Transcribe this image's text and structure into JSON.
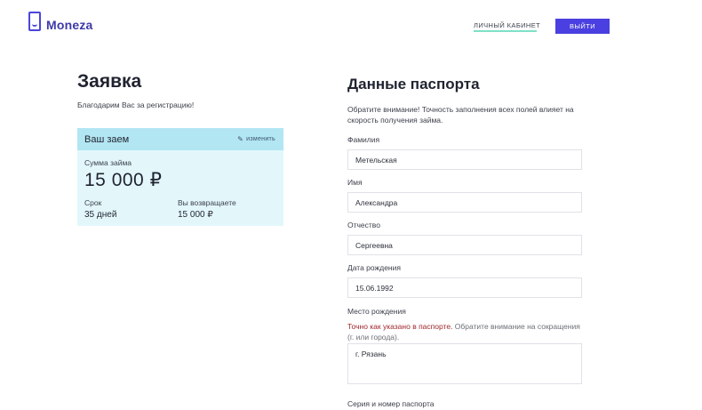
{
  "header": {
    "logo_text": "Moneza",
    "cabinet_label": "ЛИЧНЫЙ КАБИНЕТ",
    "logout_label": "ВЫЙТИ",
    "accent_color": "#4a3fe0"
  },
  "application": {
    "title": "Заявка",
    "thanks": "Благодарим Вас за регистрацию!"
  },
  "loan": {
    "title": "Ваш заем",
    "edit_label": "изменить",
    "sum_label": "Сумма займа",
    "sum_value": "15 000 ₽",
    "term_label": "Срок",
    "term_value": "35 дней",
    "return_label": "Вы возвращаете",
    "return_value": "15 000 ₽"
  },
  "passport": {
    "title": "Данные паспорта",
    "notice": "Обратите внимание! Точность заполнения всех полей влияет на скорость получения займа.",
    "surname_label": "Фамилия",
    "surname_value": "Метельская",
    "name_label": "Имя",
    "name_value": "Александра",
    "patronymic_label": "Отчество",
    "patronymic_value": "Сергеевна",
    "birthdate_label": "Дата рождения",
    "birthdate_value": "15.06.1992",
    "birthplace_label": "Место рождения",
    "birthplace_hint_red": "Точно как указано в паспорте.",
    "birthplace_hint_rest": " Обратите внимание на сокращения (г. или города).",
    "birthplace_value": "г. Рязань",
    "series_label": "Серия и номер паспорта"
  }
}
